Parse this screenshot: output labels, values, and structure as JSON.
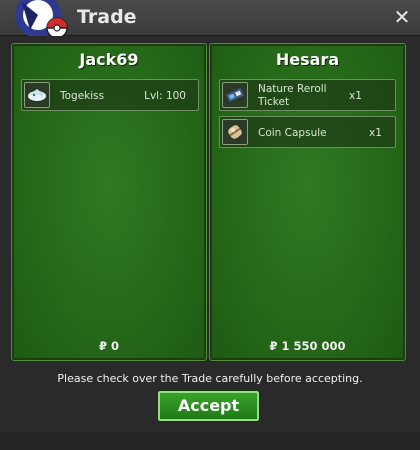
{
  "window": {
    "title": "Trade",
    "close_label": "✕"
  },
  "left_panel": {
    "player": "Jack69",
    "items": [
      {
        "name": "Togekiss",
        "level": "Lvl: 100",
        "icon": "togekiss-icon"
      }
    ],
    "money": "₽ 0"
  },
  "right_panel": {
    "player": "Hesara",
    "items": [
      {
        "name_line1": "Nature Reroll",
        "name_line2": "Ticket",
        "qty": "x1",
        "icon": "ticket-icon"
      },
      {
        "name": "Coin Capsule",
        "qty": "x1",
        "icon": "capsule-icon"
      }
    ],
    "money": "₽ 1 550 000"
  },
  "footer": {
    "notice": "Please check over the Trade carefully before accepting.",
    "accept_label": "Accept"
  },
  "colors": {
    "panel_green": "#256818",
    "accept_green": "#2a8f20"
  }
}
